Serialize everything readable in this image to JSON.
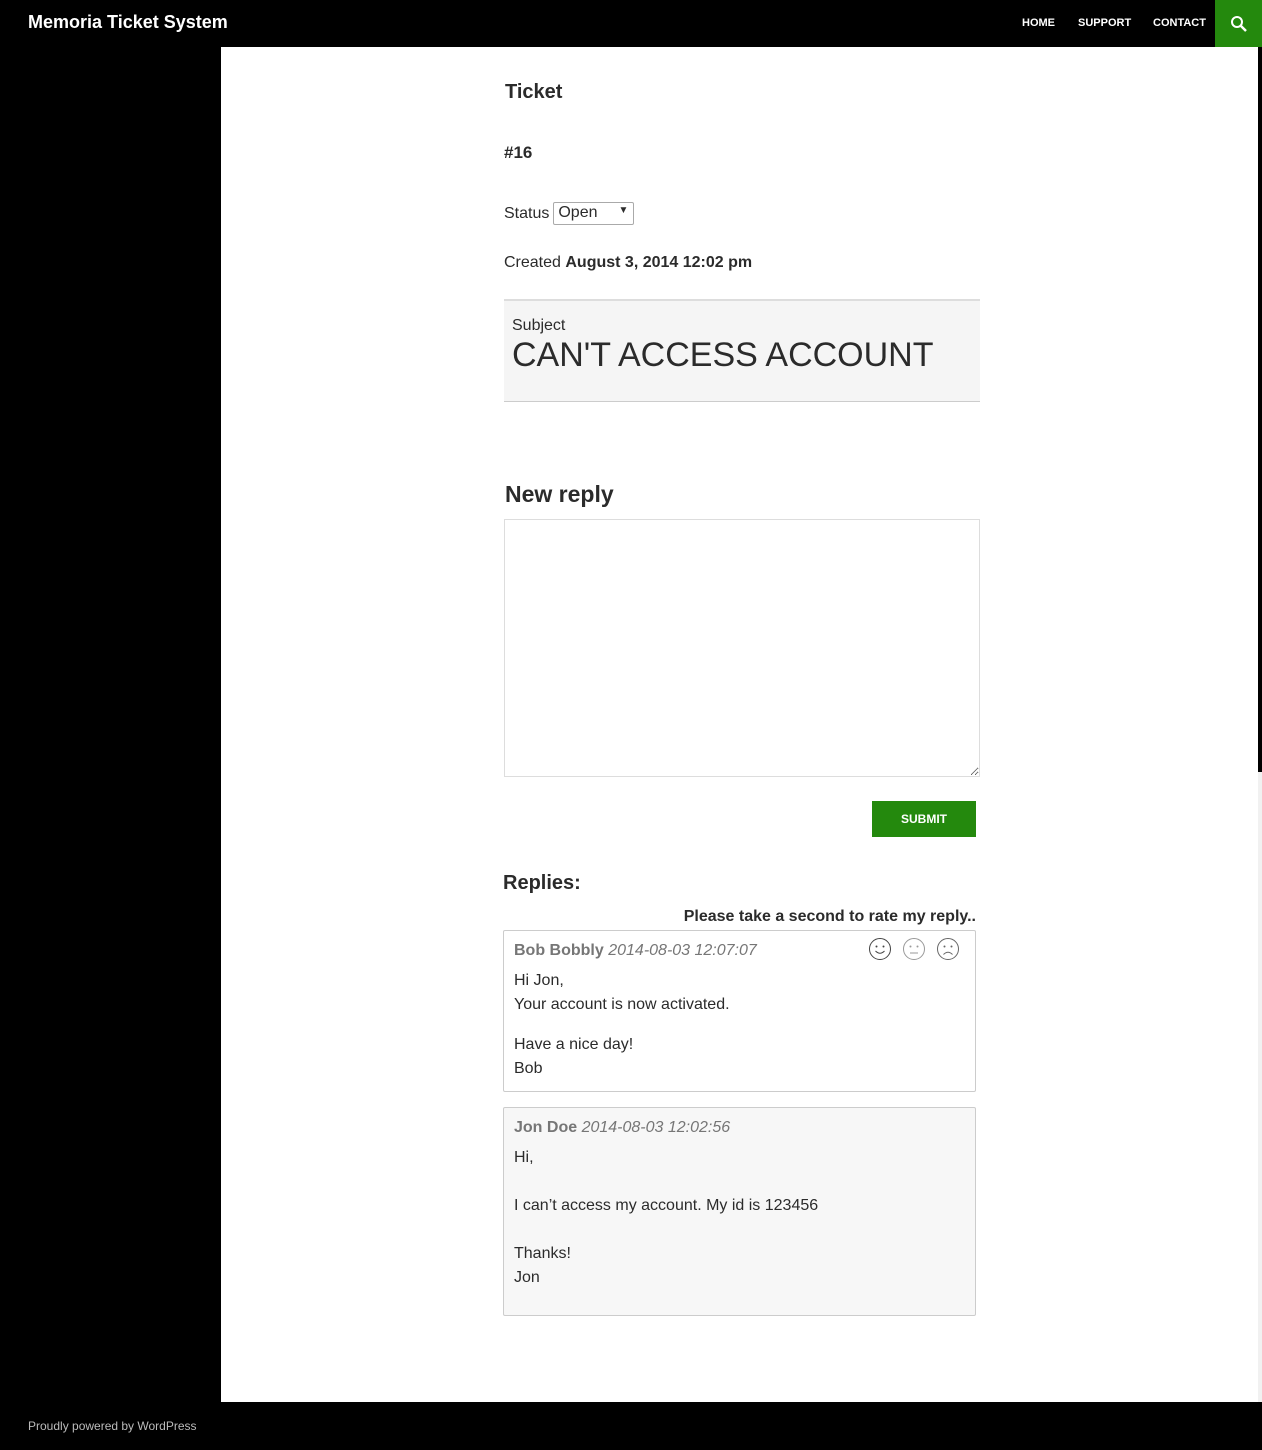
{
  "header": {
    "site_title": "Memoria Ticket System",
    "nav": [
      "HOME",
      "SUPPORT",
      "CONTACT"
    ],
    "search_icon": "search-icon",
    "accent": "#24890d"
  },
  "ticket": {
    "heading": "Ticket",
    "number": "#16",
    "status_label": "Status",
    "status_value": "Open",
    "created_label": "Created",
    "created_value": "August 3, 2014 12:02 pm",
    "subject_label": "Subject",
    "subject": "CAN'T ACCESS ACCOUNT"
  },
  "new_reply": {
    "heading": "New reply",
    "textarea_value": "",
    "submit_label": "SUBMIT"
  },
  "replies": {
    "heading": "Replies:",
    "rate_prompt": "Please take a second to rate my reply..",
    "items": [
      {
        "author": "Bob Bobbly",
        "timestamp": "2014-08-03 12:07:07",
        "lines": [
          "Hi Jon,",
          "Your account is now activated.",
          "",
          "Have a nice day!",
          "Bob"
        ],
        "rating_icons": [
          "happy-face-icon",
          "neutral-face-icon",
          "sad-face-icon"
        ]
      },
      {
        "author": "Jon Doe",
        "timestamp": "2014-08-03 12:02:56",
        "lines": [
          "Hi,",
          "",
          "I can’t access my account. My id is 123456",
          "",
          "Thanks!",
          "Jon"
        ]
      }
    ]
  },
  "footer": {
    "text": "Proudly powered by WordPress"
  }
}
